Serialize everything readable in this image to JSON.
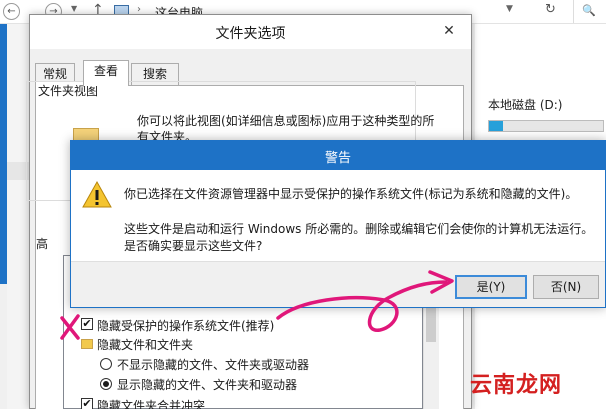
{
  "explorer": {
    "breadcrumb": "这台电脑",
    "drive": {
      "label": "本地磁盘 (D:)",
      "free_text": "",
      "used_fraction": 0.12
    }
  },
  "folder_options": {
    "title": "文件夹选项",
    "tabs": [
      {
        "label": "常规",
        "active": false
      },
      {
        "label": "查看",
        "active": true
      },
      {
        "label": "搜索",
        "active": false
      }
    ],
    "folder_view": {
      "label": "文件夹视图",
      "description": "你可以将此视图(如详细信息或图标)应用于这种类型的所有文件夹。"
    },
    "advanced_label": "高",
    "options": [
      {
        "type": "checkbox",
        "checked": true,
        "label": "隐藏受保护的操作系统文件(推荐)"
      },
      {
        "type": "folder",
        "label": "隐藏文件和文件夹"
      },
      {
        "type": "radio",
        "checked": false,
        "label": "不显示隐藏的文件、文件夹或驱动器"
      },
      {
        "type": "radio",
        "checked": true,
        "label": "显示隐藏的文件、文件夹和驱动器"
      },
      {
        "type": "checkbox",
        "checked": true,
        "label": "隐藏文件夹合并冲突"
      }
    ]
  },
  "warning": {
    "title": "警告",
    "line1": "你已选择在文件资源管理器中显示受保护的操作系统文件(标记为系统和隐藏的文件)。",
    "line2": "这些文件是启动和运行 Windows 所必需的。删除或编辑它们会使你的计算机无法运行。",
    "line3": "是否确实要显示这些文件?",
    "yes_label": "是(Y)",
    "no_label": "否(N)"
  },
  "colors": {
    "accent": "#1e72c6",
    "annotation": "#e0177a",
    "watermark": "#d42020"
  },
  "icons": [
    "back-icon",
    "forward-icon",
    "up-icon",
    "computer-icon",
    "refresh-icon",
    "search-icon",
    "close-icon",
    "warning-icon",
    "folder-icon",
    "drive-icon"
  ],
  "watermark": "云南龙网"
}
